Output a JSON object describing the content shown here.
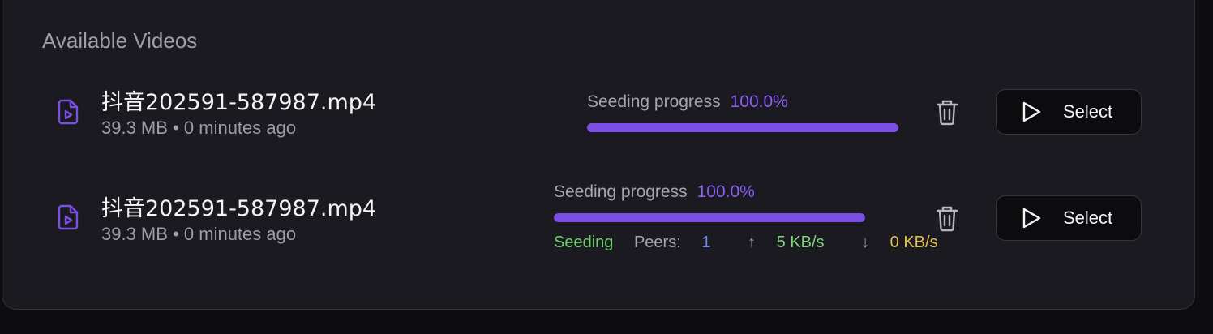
{
  "section": {
    "title": "Available Videos"
  },
  "videos": [
    {
      "name": "抖音202591-587987.mp4",
      "size": "39.3 MB",
      "separator": "•",
      "age": "0 minutes ago",
      "progress_label": "Seeding progress",
      "progress_pct": "100.0%",
      "progress_fraction": 1.0,
      "select_label": "Select",
      "icons": [
        "video-file-icon",
        "trash-icon",
        "play-icon"
      ]
    },
    {
      "name": "抖音202591-587987.mp4",
      "size": "39.3 MB",
      "separator": "•",
      "age": "0 minutes ago",
      "progress_label": "Seeding progress",
      "progress_pct": "100.0%",
      "progress_fraction": 1.0,
      "status": "Seeding",
      "peers_label": "Peers:",
      "peers_value": "1",
      "upload_arrow": "↑",
      "upload": "5 KB/s",
      "download_arrow": "↓",
      "download": "0 KB/s",
      "select_label": "Select",
      "icons": [
        "video-file-icon",
        "trash-icon",
        "play-icon"
      ]
    }
  ],
  "colors": {
    "accent": "#8b5cf6",
    "progress_fill": "#7b4ee4",
    "status_seeding": "#6fcf6f",
    "peers": "#6b8cf0",
    "upload": "#7fd37f",
    "download": "#e3c24c"
  }
}
